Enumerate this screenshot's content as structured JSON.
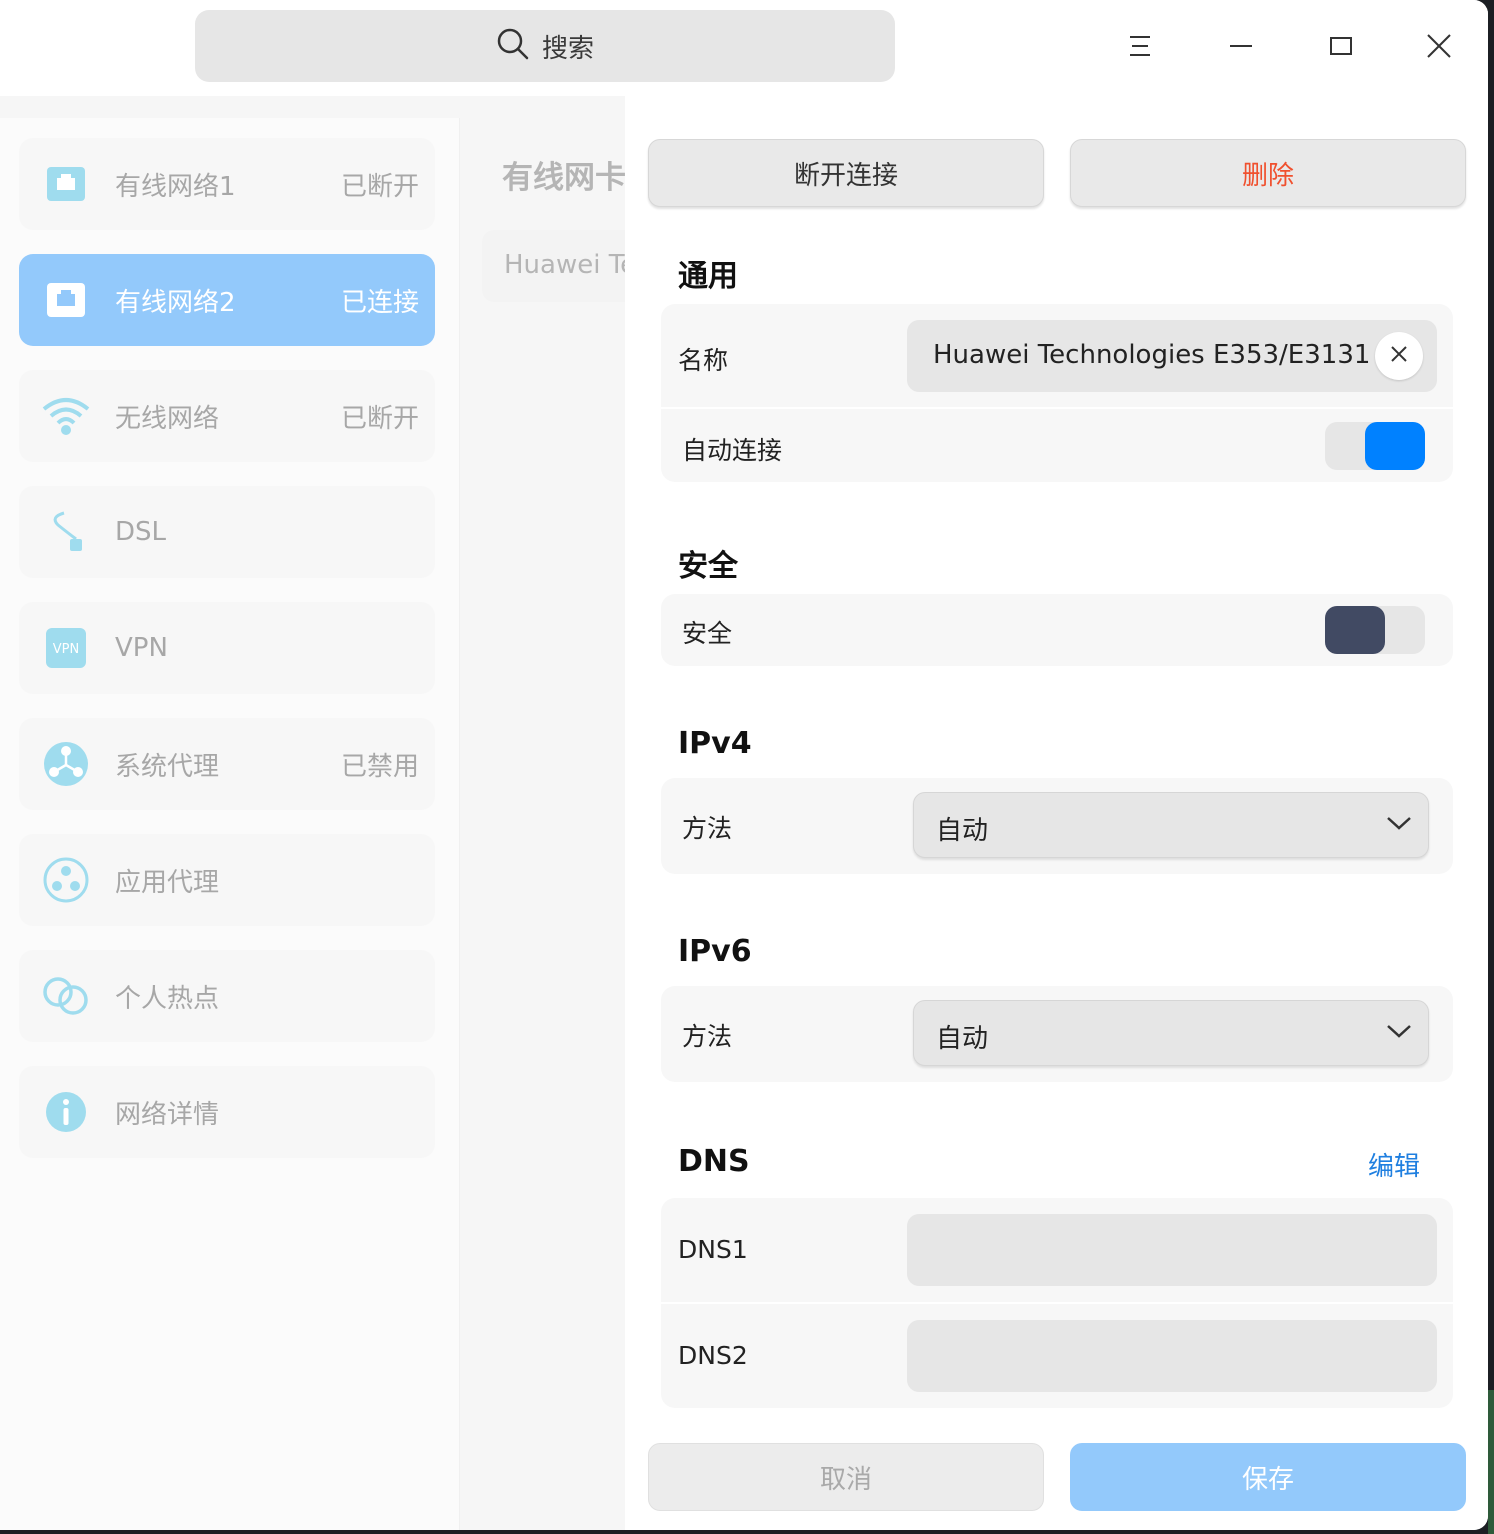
{
  "titlebar": {
    "search_label": "搜索"
  },
  "sidebar": {
    "items": [
      {
        "name": "有线网络1",
        "status": "已断开",
        "icon": "ethernet-icon"
      },
      {
        "name": "有线网络2",
        "status": "已连接",
        "icon": "ethernet-icon"
      },
      {
        "name": "无线网络",
        "status": "已断开",
        "icon": "wifi-icon"
      },
      {
        "name": "DSL",
        "status": "",
        "icon": "dsl-cable-icon"
      },
      {
        "name": "VPN",
        "status": "",
        "icon": "vpn-icon"
      },
      {
        "name": "系统代理",
        "status": "已禁用",
        "icon": "system-proxy-icon"
      },
      {
        "name": "应用代理",
        "status": "",
        "icon": "app-proxy-icon"
      },
      {
        "name": "个人热点",
        "status": "",
        "icon": "hotspot-icon"
      },
      {
        "name": "网络详情",
        "status": "",
        "icon": "info-icon"
      }
    ],
    "active_index": 1
  },
  "middle": {
    "title": "有线网卡",
    "card_text": "Huawei Te"
  },
  "panel": {
    "disconnect_label": "断开连接",
    "delete_label": "删除",
    "general": {
      "title": "通用",
      "name_label": "名称",
      "name_value": "Huawei Technologies E353/E3131",
      "auto_connect_label": "自动连接",
      "auto_connect": true
    },
    "security": {
      "title": "安全",
      "security_label": "安全",
      "security_enabled": false
    },
    "ipv4": {
      "title": "IPv4",
      "method_label": "方法",
      "method_value": "自动"
    },
    "ipv6": {
      "title": "IPv6",
      "method_label": "方法",
      "method_value": "自动"
    },
    "dns": {
      "title": "DNS",
      "edit_label": "编辑",
      "dns1_label": "DNS1",
      "dns1_value": "",
      "dns2_label": "DNS2",
      "dns2_value": ""
    },
    "cancel_label": "取消",
    "save_label": "保存"
  },
  "colors": {
    "accent": "#0081ff",
    "active_nav": "#93c9fb",
    "delete_text": "#f0502e",
    "edit_link": "#1f7fe0"
  }
}
